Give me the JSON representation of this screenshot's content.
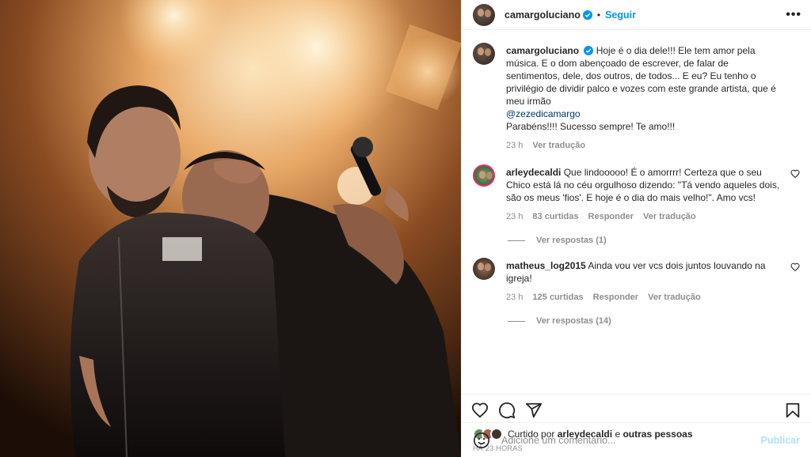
{
  "post": {
    "author": "camargoluciano",
    "follow_label": "Seguir",
    "dot": "•",
    "more_label": "•••",
    "caption_lines": [
      "Hoje é o dia dele!!! Ele tem amor pela música. E o dom abençoado de escrever, de falar de sentimentos, dele, dos outros, de todos... E eu? Eu tenho o privilégio de dividir palco e vozes com este grande artista, que é meu irmão",
      "@zezedicamargo",
      "Parabéns!!!! Sucesso sempre! Te amo!!!"
    ],
    "caption_time": "23 h",
    "caption_translate": "Ver tradução"
  },
  "comments": [
    {
      "user": "arleydecaldi",
      "text": "Que lindooooo! É o amorrrr! Certeza que o seu Chico está lá no céu orgulhoso dizendo: \"Tá vendo aqueles dois, são os meus 'fios'. E hoje é o dia do mais velho!\". Amo vcs!",
      "time": "23 h",
      "likes": "83 curtidas",
      "reply": "Responder",
      "translate": "Ver tradução",
      "replies": "Ver respostas (1)"
    },
    {
      "user": "matheus_log2015",
      "text": "Ainda vou ver vcs dois juntos louvando na igreja!",
      "time": "23 h",
      "likes": "125 curtidas",
      "reply": "Responder",
      "translate": "Ver tradução",
      "replies": "Ver respostas (14)"
    }
  ],
  "likes": {
    "prefix": "Curtido por",
    "user": "arleydecaldi",
    "conj": "e",
    "others": "outras pessoas"
  },
  "posted_ago": "HÁ 23 HORAS",
  "add_comment": {
    "placeholder": "Adicione um comentário...",
    "publish_label": "Publicar"
  },
  "icons": {
    "like": "heart-icon",
    "comment": "comment-icon",
    "share": "share-icon",
    "save": "bookmark-icon",
    "emoji": "emoji-icon",
    "verified": "verified-badge-icon"
  },
  "colors": {
    "accent": "#0095f6",
    "mention": "#00376b",
    "muted": "#8e8e8e",
    "publish_disabled": "#b2dffc"
  }
}
